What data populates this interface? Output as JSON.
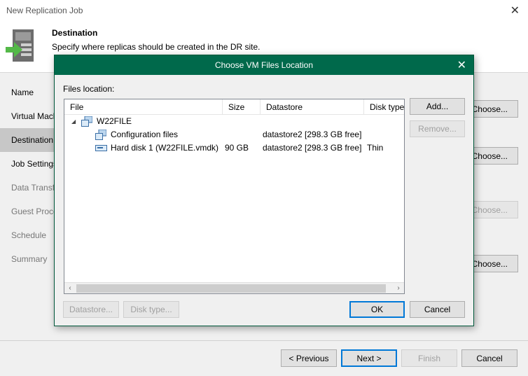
{
  "wizard": {
    "window_title": "New Replication Job",
    "header": {
      "title": "Destination",
      "subtitle": "Specify where replicas should be created in the DR site."
    },
    "steps": [
      {
        "label": "Name",
        "state": "normal"
      },
      {
        "label": "Virtual Machines",
        "state": "normal"
      },
      {
        "label": "Destination",
        "state": "active"
      },
      {
        "label": "Job Settings",
        "state": "normal"
      },
      {
        "label": "Data Transfer",
        "state": "dim"
      },
      {
        "label": "Guest Processing",
        "state": "dim"
      },
      {
        "label": "Schedule",
        "state": "dim"
      },
      {
        "label": "Summary",
        "state": "dim"
      }
    ],
    "choose_buttons": [
      {
        "label": "Choose...",
        "enabled": true
      },
      {
        "label": "Choose...",
        "enabled": true
      },
      {
        "label": "Choose...",
        "enabled": false
      },
      {
        "label": "Choose...",
        "enabled": true
      }
    ],
    "footer": {
      "previous": "< Previous",
      "next": "Next >",
      "finish": "Finish",
      "cancel": "Cancel"
    }
  },
  "dialog": {
    "title": "Choose VM Files Location",
    "files_location_label": "Files location:",
    "columns": [
      "File",
      "Size",
      "Datastore",
      "Disk type"
    ],
    "rows": [
      {
        "file": "W22FILE",
        "size": "",
        "datastore": "",
        "disk_type": "",
        "level": 0,
        "icon": "vm-icon"
      },
      {
        "file": "Configuration files",
        "size": "",
        "datastore": "datastore2 [298.3 GB free]",
        "disk_type": "",
        "level": 1,
        "icon": "config-files-icon"
      },
      {
        "file": "Hard disk 1 (W22FILE.vmdk)",
        "size": "90 GB",
        "datastore": "datastore2 [298.3 GB free]",
        "disk_type": "Thin",
        "level": 1,
        "icon": "hard-disk-icon"
      }
    ],
    "buttons": {
      "add": "Add...",
      "remove": "Remove...",
      "datastore": "Datastore...",
      "disk_type": "Disk type...",
      "ok": "OK",
      "cancel": "Cancel"
    }
  },
  "colors": {
    "dialog_titlebar": "#00694b",
    "active_step": "#c7c7c7",
    "focus_border": "#0078d7"
  }
}
